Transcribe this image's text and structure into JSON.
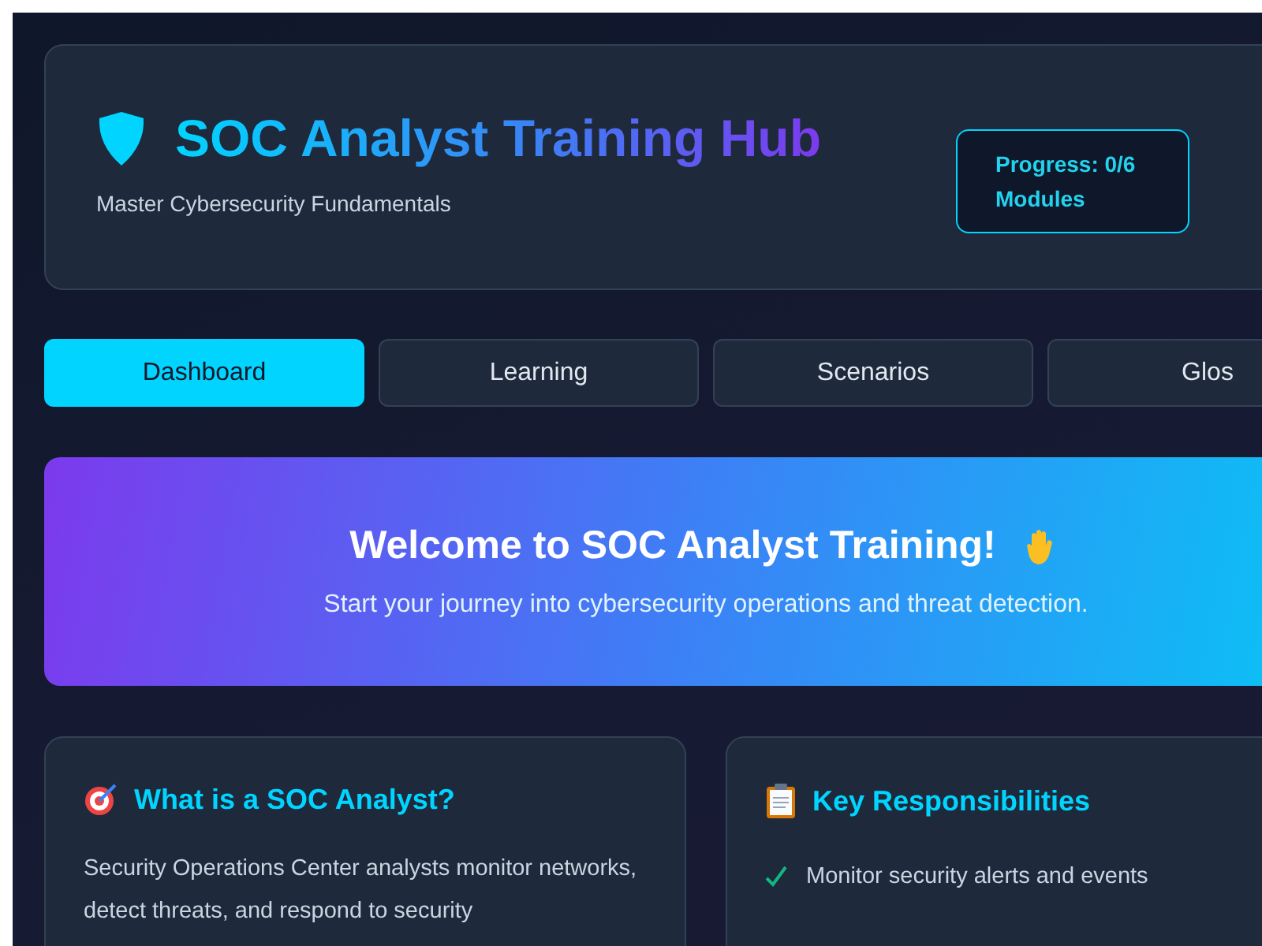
{
  "header": {
    "title": "SOC Analyst Training Hub",
    "subtitle": "Master Cybersecurity Fundamentals",
    "progress": "Progress: 0/6 Modules"
  },
  "tabs": [
    {
      "label": "Dashboard",
      "selected": true
    },
    {
      "label": "Learning",
      "selected": false
    },
    {
      "label": "Scenarios",
      "selected": false
    },
    {
      "label": "Glos",
      "selected": false
    }
  ],
  "banner": {
    "title": "Welcome to SOC Analyst Training!",
    "text": "Start your journey into cybersecurity operations and threat detection."
  },
  "cards": [
    {
      "kind": "text",
      "title": "What is a SOC Analyst?",
      "text": "Security Operations Center analysts monitor networks, detect threats, and respond to security"
    },
    {
      "kind": "list",
      "title": "Key Responsibilities",
      "items": [
        "Monitor security alerts and events"
      ]
    }
  ]
}
